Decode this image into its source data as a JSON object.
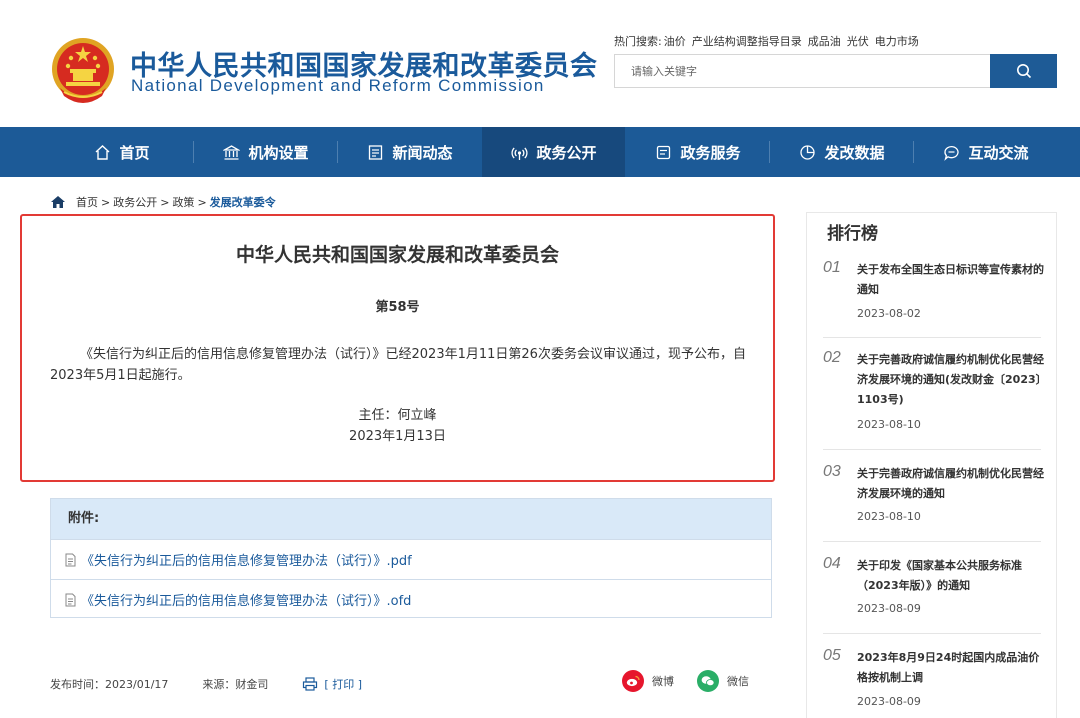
{
  "header": {
    "title_cn": "中华人民共和国国家发展和改革委员会",
    "title_en": "National Development and Reform Commission",
    "hot_search_label": "热门搜索:",
    "hot_search_links": [
      "油价",
      "产业结构调整指导目录",
      "成品油",
      "光伏",
      "电力市场"
    ],
    "search_placeholder": "请输入关键字"
  },
  "nav": [
    {
      "label": "首页",
      "icon": "home-icon"
    },
    {
      "label": "机构设置",
      "icon": "institution-icon"
    },
    {
      "label": "新闻动态",
      "icon": "news-icon"
    },
    {
      "label": "政务公开",
      "icon": "broadcast-icon"
    },
    {
      "label": "政务服务",
      "icon": "service-icon"
    },
    {
      "label": "发改数据",
      "icon": "pie-chart-icon"
    },
    {
      "label": "互动交流",
      "icon": "chat-icon"
    }
  ],
  "breadcrumb": {
    "items": [
      "首页",
      "政务公开",
      "政策"
    ],
    "current": "发展改革委令",
    "separator": ">"
  },
  "document": {
    "issuer": "中华人民共和国国家发展和改革委员会",
    "number": "第58号",
    "body": "《失信行为纠正后的信用信息修复管理办法（试行）》已经2023年1月11日第26次委务会议审议通过，现予公布，自2023年5月1日起施行。",
    "signer": "主任：何立峰",
    "date": "2023年1月13日"
  },
  "attachments": {
    "label": "附件:",
    "files": [
      "《失信行为纠正后的信用信息修复管理办法（试行）》.pdf",
      "《失信行为纠正后的信用信息修复管理办法（试行）》.ofd"
    ]
  },
  "meta": {
    "publish_time": "发布时间：2023/01/17",
    "source": "来源：财金司",
    "print_label": "[ 打印 ]",
    "share_weibo": "微博",
    "share_wechat": "微信"
  },
  "ranking": {
    "title": "排行榜",
    "items": [
      {
        "num": "01",
        "title": "关于发布全国生态日标识等宣传素材的通知",
        "date": "2023-08-02"
      },
      {
        "num": "02",
        "title": "关于完善政府诚信履约机制优化民营经济发展环境的通知(发改财金〔2023〕1103号)",
        "date": "2023-08-10"
      },
      {
        "num": "03",
        "title": "关于完善政府诚信履约机制优化民营经济发展环境的通知",
        "date": "2023-08-10"
      },
      {
        "num": "04",
        "title": "关于印发《国家基本公共服务标准（2023年版）》的通知",
        "date": "2023-08-09"
      },
      {
        "num": "05",
        "title": "2023年8月9日24时起国内成品油价格按机制上调",
        "date": "2023-08-09"
      }
    ]
  },
  "colors": {
    "brand_blue": "#1c5a97",
    "highlight_red": "#e23a35",
    "attach_header_bg": "#d9e9f8",
    "weibo_red": "#e6162d",
    "wechat_green": "#2aae67"
  }
}
